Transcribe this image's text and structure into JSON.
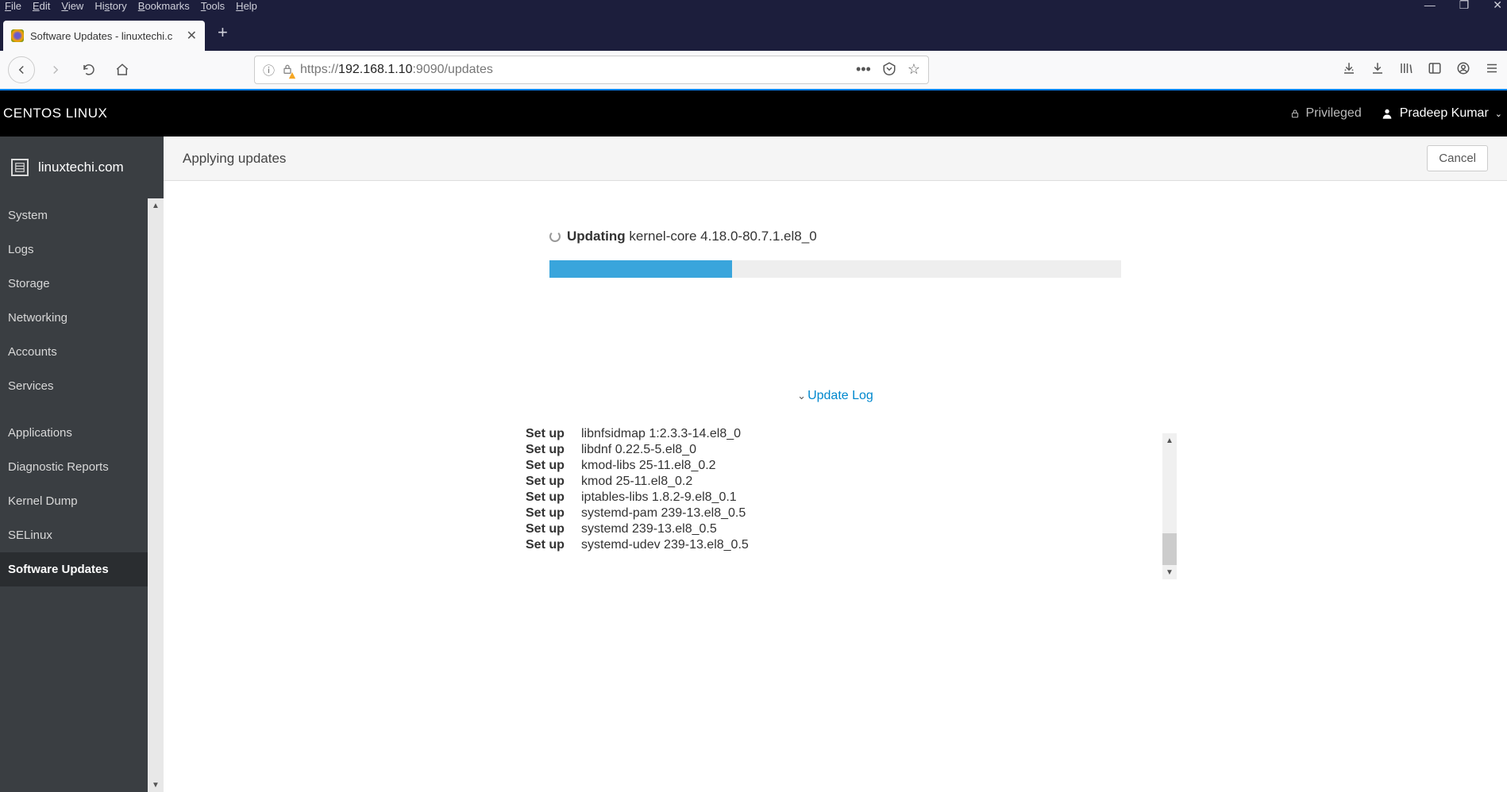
{
  "window": {
    "menu": [
      "File",
      "Edit",
      "View",
      "History",
      "Bookmarks",
      "Tools",
      "Help"
    ],
    "controls": {
      "min": "—",
      "max": "❐",
      "close": "✕"
    }
  },
  "browser": {
    "tab_title": "Software Updates - linuxtechi.c",
    "url_prefix": "https://",
    "url_host": "192.168.1.10",
    "url_port_path": ":9090/updates"
  },
  "cockpit": {
    "brand": "CENTOS LINUX",
    "privileged_label": "Privileged",
    "user_name": "Pradeep Kumar",
    "host": "linuxtechi.com"
  },
  "sidebar": {
    "items": [
      {
        "label": "System"
      },
      {
        "label": "Logs"
      },
      {
        "label": "Storage"
      },
      {
        "label": "Networking"
      },
      {
        "label": "Accounts"
      },
      {
        "label": "Services"
      }
    ],
    "items2": [
      {
        "label": "Applications"
      },
      {
        "label": "Diagnostic Reports"
      },
      {
        "label": "Kernel Dump"
      },
      {
        "label": "SELinux"
      },
      {
        "label": "Software Updates",
        "active": true
      }
    ]
  },
  "page": {
    "title": "Applying updates",
    "cancel": "Cancel",
    "status_action": "Updating",
    "status_pkg": "kernel-core 4.18.0-80.7.1.el8_0",
    "log_toggle": "Update Log",
    "log": [
      {
        "action": "Set up",
        "pkg": "libnfsidmap 1:2.3.3-14.el8_0"
      },
      {
        "action": "Set up",
        "pkg": "libdnf 0.22.5-5.el8_0"
      },
      {
        "action": "Set up",
        "pkg": "kmod-libs 25-11.el8_0.2"
      },
      {
        "action": "Set up",
        "pkg": "kmod 25-11.el8_0.2"
      },
      {
        "action": "Set up",
        "pkg": "iptables-libs 1.8.2-9.el8_0.1"
      },
      {
        "action": "Set up",
        "pkg": "systemd-pam 239-13.el8_0.5"
      },
      {
        "action": "Set up",
        "pkg": "systemd 239-13.el8_0.5"
      },
      {
        "action": "Set up",
        "pkg": "systemd-udev 239-13.el8_0.5"
      }
    ]
  }
}
